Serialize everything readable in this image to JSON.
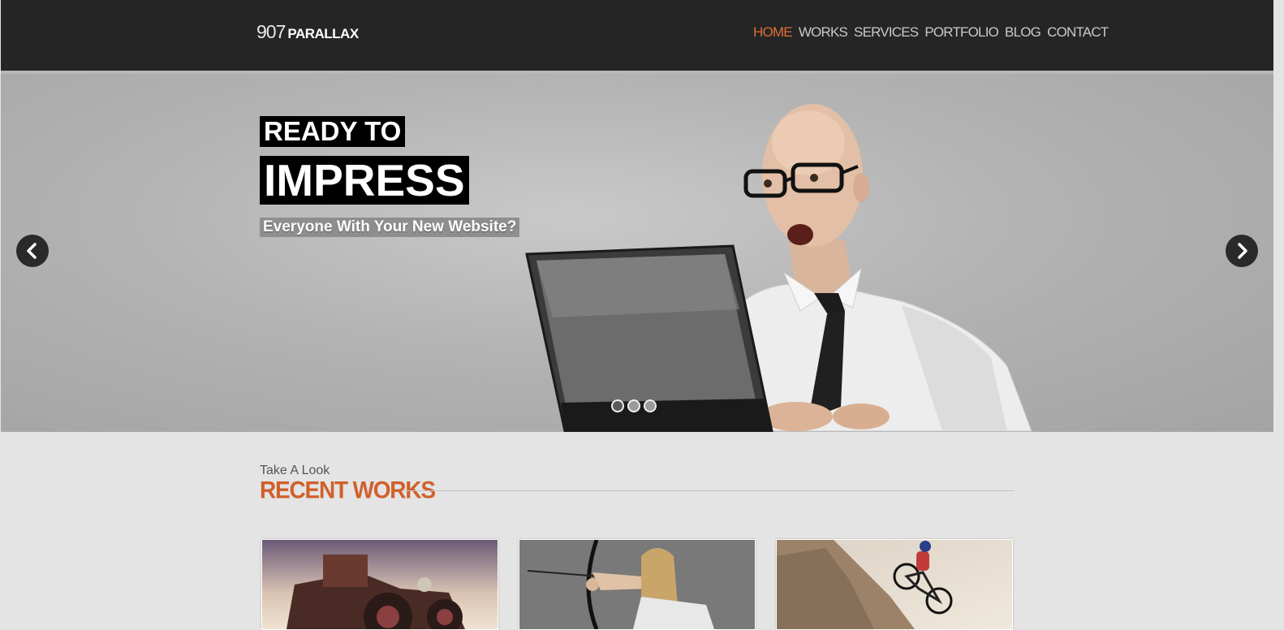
{
  "brand": {
    "number": "907",
    "name": "PARALLAX"
  },
  "nav": {
    "items": [
      {
        "label": "HOME",
        "active": true
      },
      {
        "label": "WORKS",
        "active": false
      },
      {
        "label": "SERVICES",
        "active": false
      },
      {
        "label": "PORTFOLIO",
        "active": false
      },
      {
        "label": "BLOG",
        "active": false
      },
      {
        "label": "CONTACT",
        "active": false
      }
    ]
  },
  "hero": {
    "line1": "READY TO",
    "line2": "IMPRESS",
    "line3": "Everyone With Your New Website?",
    "slide_count": 3,
    "active_slide": 1
  },
  "works": {
    "kicker": "Take A Look",
    "title": "RECENT WORKS",
    "items": [
      {
        "subject": "vintage-car"
      },
      {
        "subject": "archer"
      },
      {
        "subject": "mountain-biker"
      }
    ]
  },
  "colors": {
    "accent": "#e06d37",
    "heading": "#d0602b",
    "topbar": "#252525"
  }
}
